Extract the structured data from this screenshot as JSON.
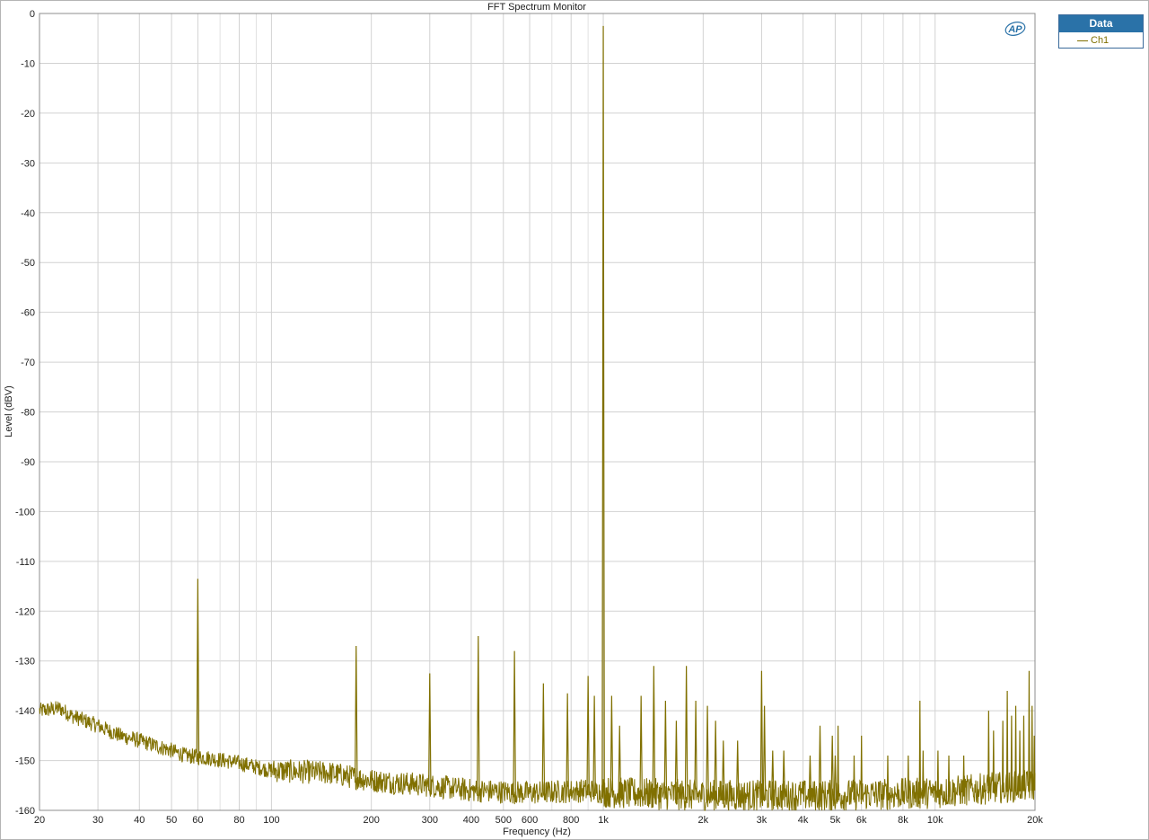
{
  "window": {
    "title": "FFT Spectrum Monitor"
  },
  "legend": {
    "header": "Data",
    "entries": [
      {
        "label": "Ch1",
        "color": "#807000"
      }
    ]
  },
  "logo": {
    "text": "AP",
    "color": "#2a72a8"
  },
  "chart_data": {
    "type": "line",
    "title": "FFT Spectrum Monitor",
    "xlabel": "Frequency (Hz)",
    "ylabel": "Level (dBV)",
    "x_scale": "log",
    "xlim": [
      20,
      20000
    ],
    "ylim": [
      -160,
      0
    ],
    "grid": true,
    "legend_position": "top-right outside plot",
    "line_color": "#807000",
    "x_ticks": [
      {
        "value": 20,
        "label": "20"
      },
      {
        "value": 30,
        "label": "30"
      },
      {
        "value": 40,
        "label": "40"
      },
      {
        "value": 50,
        "label": "50"
      },
      {
        "value": 60,
        "label": "60"
      },
      {
        "value": 80,
        "label": "80"
      },
      {
        "value": 100,
        "label": "100"
      },
      {
        "value": 200,
        "label": "200"
      },
      {
        "value": 300,
        "label": "300"
      },
      {
        "value": 400,
        "label": "400"
      },
      {
        "value": 500,
        "label": "500"
      },
      {
        "value": 600,
        "label": "600"
      },
      {
        "value": 800,
        "label": "800"
      },
      {
        "value": 1000,
        "label": "1k"
      },
      {
        "value": 2000,
        "label": "2k"
      },
      {
        "value": 3000,
        "label": "3k"
      },
      {
        "value": 4000,
        "label": "4k"
      },
      {
        "value": 5000,
        "label": "5k"
      },
      {
        "value": 6000,
        "label": "6k"
      },
      {
        "value": 8000,
        "label": "8k"
      },
      {
        "value": 10000,
        "label": "10k"
      },
      {
        "value": 20000,
        "label": "20k"
      }
    ],
    "x_minor_grid": [
      70,
      90,
      700,
      900,
      7000,
      9000
    ],
    "y_ticks": [
      0,
      -10,
      -20,
      -30,
      -40,
      -50,
      -60,
      -70,
      -80,
      -90,
      -100,
      -110,
      -120,
      -130,
      -140,
      -150,
      -160
    ],
    "noise_floor": [
      {
        "x": 20,
        "y": -140
      },
      {
        "x": 23,
        "y": -139.5
      },
      {
        "x": 25,
        "y": -141
      },
      {
        "x": 30,
        "y": -143
      },
      {
        "x": 35,
        "y": -145
      },
      {
        "x": 40,
        "y": -146
      },
      {
        "x": 50,
        "y": -148
      },
      {
        "x": 55,
        "y": -149
      },
      {
        "x": 65,
        "y": -149.5
      },
      {
        "x": 80,
        "y": -150.5
      },
      {
        "x": 100,
        "y": -152
      },
      {
        "x": 150,
        "y": -152.5
      },
      {
        "x": 200,
        "y": -154
      },
      {
        "x": 300,
        "y": -155
      },
      {
        "x": 400,
        "y": -156
      },
      {
        "x": 600,
        "y": -156.5
      },
      {
        "x": 900,
        "y": -156
      },
      {
        "x": 1100,
        "y": -156.5
      },
      {
        "x": 2000,
        "y": -157
      },
      {
        "x": 5000,
        "y": -157
      },
      {
        "x": 10000,
        "y": -156.5
      },
      {
        "x": 15000,
        "y": -155.5
      },
      {
        "x": 20000,
        "y": -155
      }
    ],
    "peaks": [
      {
        "x": 60,
        "y": -113.5
      },
      {
        "x": 180,
        "y": -127
      },
      {
        "x": 300,
        "y": -132.5
      },
      {
        "x": 420,
        "y": -125
      },
      {
        "x": 540,
        "y": -128
      },
      {
        "x": 660,
        "y": -134.5
      },
      {
        "x": 780,
        "y": -136.5
      },
      {
        "x": 900,
        "y": -133
      },
      {
        "x": 940,
        "y": -137
      },
      {
        "x": 1000,
        "y": -2.5
      },
      {
        "x": 1060,
        "y": -137
      },
      {
        "x": 1120,
        "y": -143
      },
      {
        "x": 1300,
        "y": -137
      },
      {
        "x": 1420,
        "y": -131
      },
      {
        "x": 1540,
        "y": -138
      },
      {
        "x": 1660,
        "y": -142
      },
      {
        "x": 1780,
        "y": -131
      },
      {
        "x": 1900,
        "y": -138
      },
      {
        "x": 2060,
        "y": -139
      },
      {
        "x": 2180,
        "y": -142
      },
      {
        "x": 2300,
        "y": -146
      },
      {
        "x": 2540,
        "y": -146
      },
      {
        "x": 3000,
        "y": -132
      },
      {
        "x": 3060,
        "y": -139
      },
      {
        "x": 3240,
        "y": -148
      },
      {
        "x": 3500,
        "y": -148
      },
      {
        "x": 4200,
        "y": -149
      },
      {
        "x": 4500,
        "y": -143
      },
      {
        "x": 4900,
        "y": -145
      },
      {
        "x": 5000,
        "y": -149
      },
      {
        "x": 5100,
        "y": -143
      },
      {
        "x": 5700,
        "y": -149
      },
      {
        "x": 6000,
        "y": -145
      },
      {
        "x": 7200,
        "y": -149
      },
      {
        "x": 8300,
        "y": -149
      },
      {
        "x": 9000,
        "y": -138
      },
      {
        "x": 9200,
        "y": -148
      },
      {
        "x": 10200,
        "y": -148
      },
      {
        "x": 11000,
        "y": -149
      },
      {
        "x": 12200,
        "y": -149
      },
      {
        "x": 14500,
        "y": -140
      },
      {
        "x": 15000,
        "y": -144
      },
      {
        "x": 16000,
        "y": -142
      },
      {
        "x": 16500,
        "y": -136
      },
      {
        "x": 17000,
        "y": -141
      },
      {
        "x": 17500,
        "y": -139
      },
      {
        "x": 18000,
        "y": -144
      },
      {
        "x": 18500,
        "y": -141
      },
      {
        "x": 19200,
        "y": -132
      },
      {
        "x": 19600,
        "y": -139
      },
      {
        "x": 19900,
        "y": -145
      }
    ]
  }
}
